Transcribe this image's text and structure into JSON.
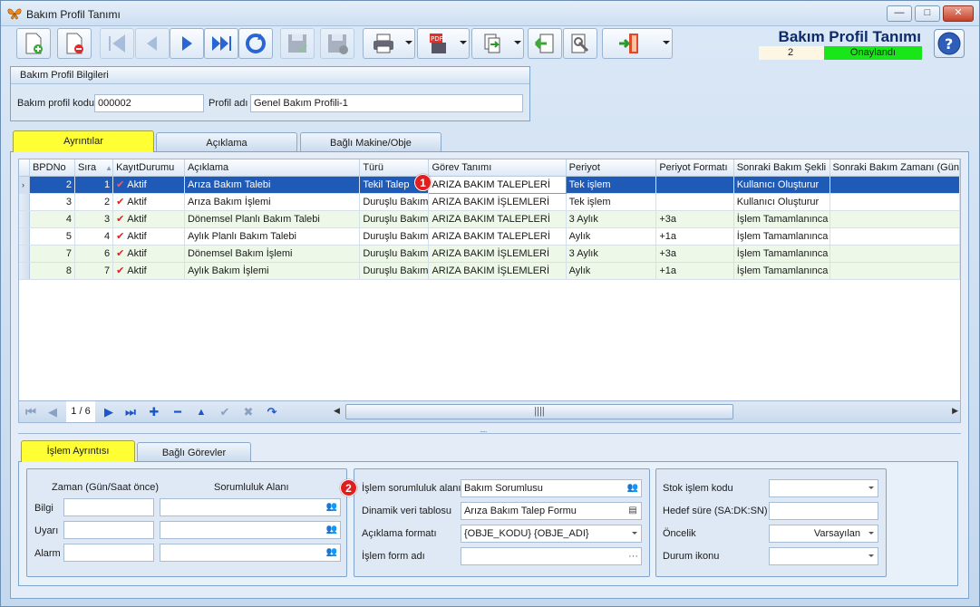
{
  "window": {
    "title": "Bakım Profil Tanımı",
    "min": "—",
    "max": "□",
    "close": "✕"
  },
  "header": {
    "title": "Bakım Profil Tanımı",
    "record_no": "2",
    "status": "Onaylandı",
    "help": "?"
  },
  "colors": {
    "status_bg": "#19e619",
    "selection": "#1f5ab6",
    "active_tab": "#ffff33",
    "badge": "#e01e1e"
  },
  "toolbar": {
    "icons": [
      "new-document-icon",
      "delete-document-icon",
      "first-record-icon",
      "previous-record-icon",
      "next-record-icon",
      "last-record-icon",
      "refresh-icon",
      "save-icon",
      "save-cancel-icon",
      "print-icon",
      "pdf-export-icon",
      "import-export-icon",
      "back-icon",
      "settings-tools-icon",
      "exit-door-icon",
      "more-options-icon"
    ]
  },
  "profile": {
    "group_title": "Bakım Profil Bilgileri",
    "code_label": "Bakım profil kodu",
    "code_value": "000002",
    "name_label": "Profil adı",
    "name_value": "Genel Bakım Profili-1"
  },
  "tabs": [
    "Ayrıntılar",
    "Açıklama",
    "Bağlı Makine/Obje"
  ],
  "grid": {
    "columns": [
      "BPDNo",
      "Sıra",
      "KayıtDurumu",
      "Açıklama",
      "Türü",
      "Görev Tanımı",
      "Periyot",
      "Periyot Formatı",
      "Sonraki Bakım Şekli",
      "Sonraki Bakım Zamanı (Gün"
    ],
    "rows": [
      {
        "bpdno": "2",
        "sira": "1",
        "durum": "Aktif",
        "aciklama": "Arıza Bakım Talebi",
        "turu": "Tekil Talep",
        "gorev": "ARIZA BAKIM TALEPLERİ",
        "periyot": "Tek işlem",
        "format": "",
        "sekil": "Kullanıcı Oluşturur",
        "zaman": ""
      },
      {
        "bpdno": "3",
        "sira": "2",
        "durum": "Aktif",
        "aciklama": "Arıza Bakım İşlemi",
        "turu": "Duruşlu Bakım",
        "gorev": "ARIZA BAKIM İŞLEMLERİ",
        "periyot": "Tek işlem",
        "format": "",
        "sekil": "Kullanıcı Oluşturur",
        "zaman": ""
      },
      {
        "bpdno": "4",
        "sira": "3",
        "durum": "Aktif",
        "aciklama": "Dönemsel Planlı Bakım Talebi",
        "turu": "Duruşlu Bakım",
        "gorev": "ARIZA BAKIM TALEPLERİ",
        "periyot": "3 Aylık",
        "format": "+3a",
        "sekil": "İşlem Tamamlanınca",
        "zaman": ""
      },
      {
        "bpdno": "5",
        "sira": "4",
        "durum": "Aktif",
        "aciklama": "Aylık Planlı Bakım Talebi",
        "turu": "Duruşlu Bakım",
        "gorev": "ARIZA BAKIM TALEPLERİ",
        "periyot": "Aylık",
        "format": "+1a",
        "sekil": "İşlem Tamamlanınca",
        "zaman": ""
      },
      {
        "bpdno": "7",
        "sira": "6",
        "durum": "Aktif",
        "aciklama": "Dönemsel Bakım İşlemi",
        "turu": "Duruşlu Bakım",
        "gorev": "ARIZA BAKIM İŞLEMLERİ",
        "periyot": "3 Aylık",
        "format": "+3a",
        "sekil": "İşlem Tamamlanınca",
        "zaman": ""
      },
      {
        "bpdno": "8",
        "sira": "7",
        "durum": "Aktif",
        "aciklama": "Aylık Bakım İşlemi",
        "turu": "Duruşlu Bakım",
        "gorev": "ARIZA BAKIM İŞLEMLERİ",
        "periyot": "Aylık",
        "format": "+1a",
        "sekil": "İşlem Tamamlanınca",
        "zaman": ""
      }
    ],
    "pager": "1 / 6",
    "scroll_grip": "||||",
    "splitter": "....."
  },
  "badges": {
    "one": "1",
    "two": "2"
  },
  "bottom_tabs": [
    "İşlem Ayrıntısı",
    "Bağlı Görevler"
  ],
  "schedule": {
    "time_header": "Zaman (Gün/Saat önce)",
    "resp_header": "Sorumluluk Alanı",
    "rows": [
      "Bilgi",
      "Uyarı",
      "Alarm"
    ]
  },
  "details": {
    "resp_label": "İşlem sorumluluk alanı",
    "resp_value": "Bakım Sorumlusu",
    "table_label": "Dinamik veri tablosu",
    "table_value": "Arıza Bakım Talep Formu",
    "format_label": "Açıklama formatı",
    "format_value": "{OBJE_KODU} {OBJE_ADI}",
    "form_label": "İşlem form adı",
    "form_value": ""
  },
  "stock": {
    "code_label": "Stok işlem kodu",
    "code_value": "",
    "target_label": "Hedef süre (SA:DK:SN)",
    "target_value": "",
    "priority_label": "Öncelik",
    "priority_value": "Varsayılan",
    "icon_label": "Durum ikonu",
    "icon_value": ""
  }
}
